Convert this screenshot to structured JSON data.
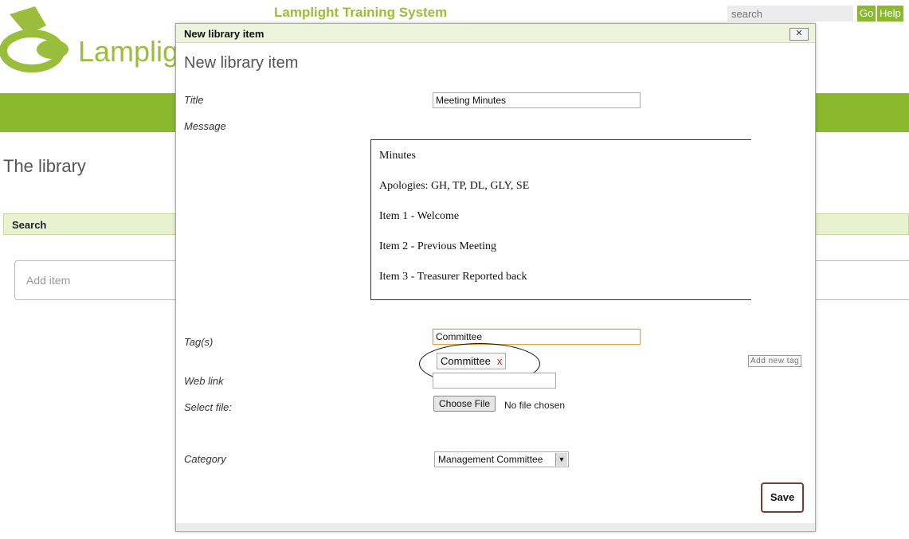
{
  "app": {
    "site_title": "Lamplight Training System",
    "logo_text": "Lamplig",
    "search_placeholder": "search",
    "go_label": "Go",
    "help_label": "Help",
    "brand_color": "#8ab92d"
  },
  "page": {
    "heading": "The library",
    "search_label": "Search",
    "add_item_placeholder": "Add item"
  },
  "modal": {
    "titlebar": "New library item",
    "close_label": "✕",
    "heading": "New library item",
    "fields": {
      "title_label": "Title",
      "title_value": "Meeting Minutes",
      "message_label": "Message",
      "message_lines": [
        "Minutes",
        "Apologies: GH, TP, DL, GLY, SE",
        "Item 1 - Welcome",
        "Item 2 - Previous Meeting",
        "Item 3 - Treasurer Reported back"
      ],
      "tags_label": "Tag(s)",
      "tags_input_value": "Committee",
      "tag_chip": "Committee",
      "tag_remove": "x",
      "add_new_tag_label": "Add new tag",
      "web_link_label": "Web link",
      "web_link_value": "",
      "select_file_label": "Select file:",
      "choose_file_label": "Choose File",
      "no_file_text": "No file chosen",
      "category_label": "Category",
      "category_value": "Management Committee"
    },
    "save_label": "Save"
  }
}
